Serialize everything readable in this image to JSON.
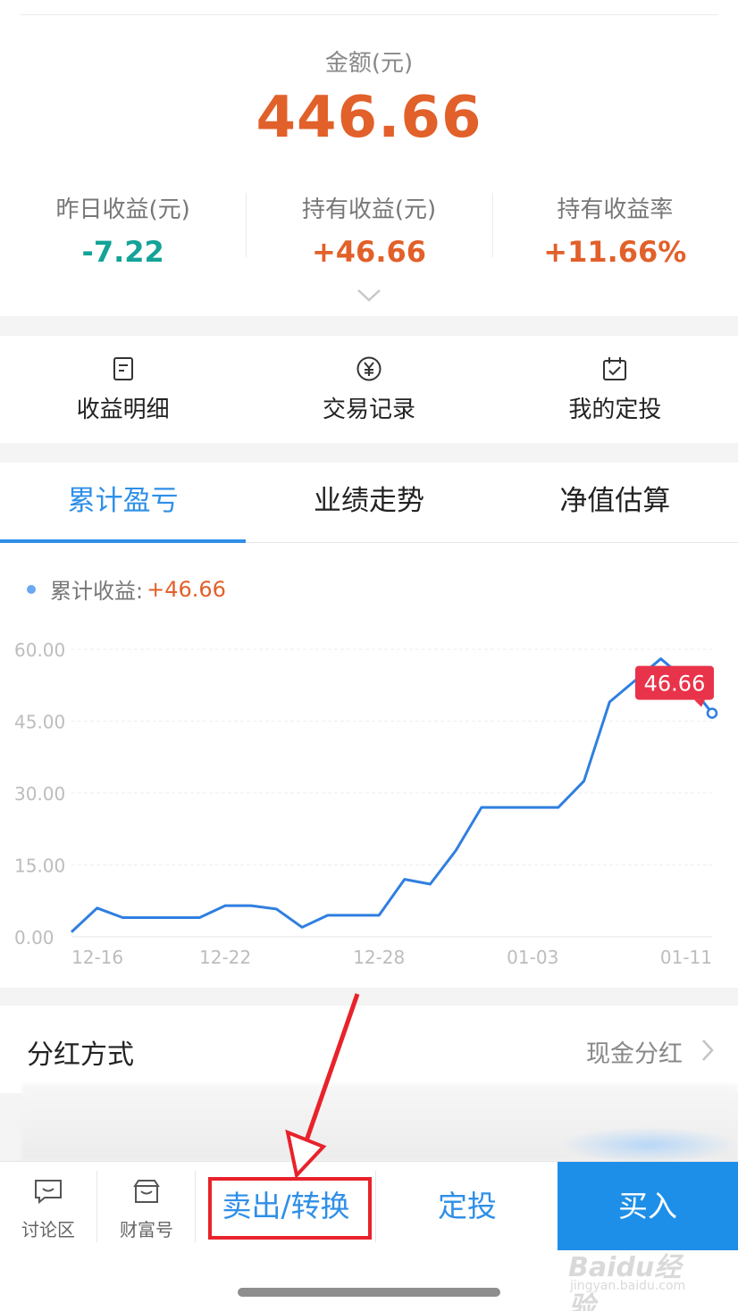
{
  "header": {
    "amount_label": "金额(元)",
    "amount_value": "446.66",
    "stats": [
      {
        "label": "昨日收益(元)",
        "value": "-7.22",
        "tone": "#14a398"
      },
      {
        "label": "持有收益(元)",
        "value": "+46.66",
        "tone": "#e2602a"
      },
      {
        "label": "持有收益率",
        "value": "+11.66%",
        "tone": "#e2602a"
      }
    ],
    "expand_icon": "chevron-down-icon"
  },
  "quick_actions": [
    {
      "label": "收益明细",
      "icon": "document-icon"
    },
    {
      "label": "交易记录",
      "icon": "yuan-circle-icon"
    },
    {
      "label": "我的定投",
      "icon": "calendar-check-icon"
    }
  ],
  "tabs": [
    {
      "label": "累计盈亏",
      "active": true
    },
    {
      "label": "业绩走势",
      "active": false
    },
    {
      "label": "净值估算",
      "active": false
    }
  ],
  "chart_legend": {
    "label": "累计收益:",
    "value": "+46.66"
  },
  "chart_data": {
    "type": "line",
    "series": [
      {
        "name": "累计收益",
        "color": "#2f7fe0",
        "values": [
          1.0,
          6.0,
          4.0,
          4.0,
          4.0,
          4.0,
          6.5,
          6.5,
          5.8,
          2.0,
          4.5,
          4.5,
          4.5,
          12.0,
          11.0,
          18.0,
          27.0,
          27.0,
          27.0,
          27.0,
          32.5,
          49.0,
          53.5,
          58.0,
          53.5,
          46.66
        ]
      }
    ],
    "x_tick_labels": [
      "12-16",
      "12-22",
      "12-28",
      "01-03",
      "01-11"
    ],
    "x_tick_index": [
      1,
      6,
      12,
      18,
      25
    ],
    "y_ticks": [
      "0.00",
      "15.00",
      "30.00",
      "45.00",
      "60.00"
    ],
    "ylim": [
      0,
      60
    ],
    "last_value_label": "46.66",
    "label_color": "#e8334a",
    "grid": true
  },
  "dividend": {
    "label": "分红方式",
    "value": "现金分红"
  },
  "bottom_bar": {
    "discussion": "讨论区",
    "wealth": "财富号",
    "sell": "卖出/转换",
    "fixed": "定投",
    "buy": "买入"
  },
  "watermark": {
    "text": "Baidu经验",
    "sub": "jingyan.baidu.com"
  }
}
